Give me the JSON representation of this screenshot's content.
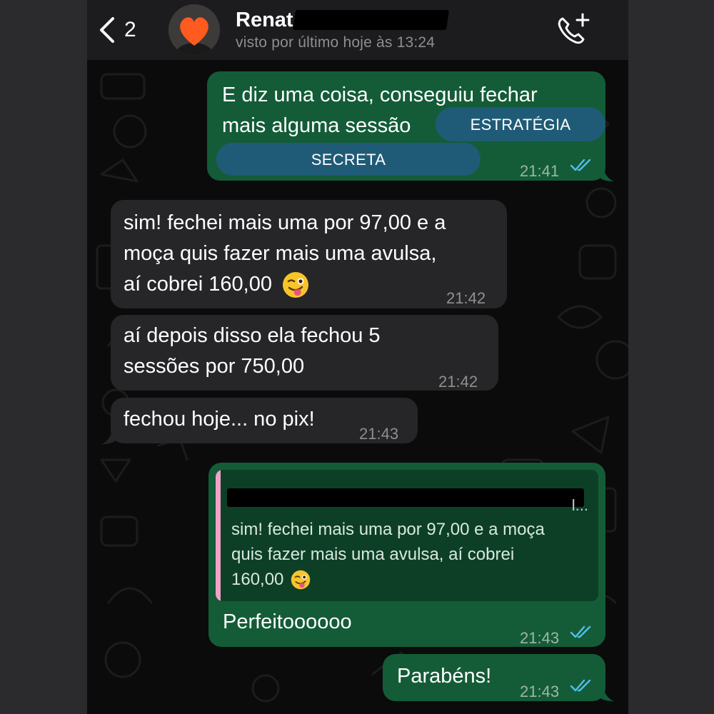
{
  "header": {
    "back_count": "2",
    "contact_name": "Renata",
    "last_seen": "visto por último hoje às 13:24"
  },
  "messages": [
    {
      "direction": "outgoing",
      "lines": [
        "E diz uma coisa, conseguiu fechar",
        "mais alguma sessão"
      ],
      "badges": [
        "ESTRATÉGIA",
        "SECRETA"
      ],
      "time": "21:41",
      "status": "read"
    },
    {
      "direction": "incoming",
      "lines": [
        "sim! fechei mais uma por 97,00 e a",
        "moça quis fazer mais uma avulsa,",
        "aí cobrei 160,00"
      ],
      "emoji": "winking-face-with-tongue",
      "time": "21:42"
    },
    {
      "direction": "incoming",
      "lines": [
        "aí depois disso ela fechou 5",
        "sessões por 750,00"
      ],
      "time": "21:42"
    },
    {
      "direction": "incoming",
      "lines": [
        "fechou hoje... no pix!"
      ],
      "time": "21:43"
    },
    {
      "direction": "outgoing",
      "quote": {
        "ellipsis": "l...",
        "lines": [
          "sim! fechei mais uma por 97,00 e a moça",
          "quis fazer mais uma avulsa, aí cobrei",
          "160,00"
        ],
        "emoji": "winking-face-with-tongue"
      },
      "lines": [
        "Perfeitoooooo"
      ],
      "time": "21:43",
      "status": "read"
    },
    {
      "direction": "outgoing",
      "lines": [
        "Parabéns!"
      ],
      "time": "21:43",
      "status": "read"
    }
  ],
  "colors": {
    "outgoing_bubble": "#135c37",
    "incoming_bubble": "#262628",
    "read_ticks": "#53bdeb",
    "badge": "#1f5b77",
    "quote_bar": "#f0a3c7",
    "avatar_heart": "#ff5a1f"
  },
  "icons": [
    "chevron-left-icon",
    "heart-icon",
    "phone-plus-icon",
    "double-check-icon",
    "winking-tongue-emoji"
  ]
}
